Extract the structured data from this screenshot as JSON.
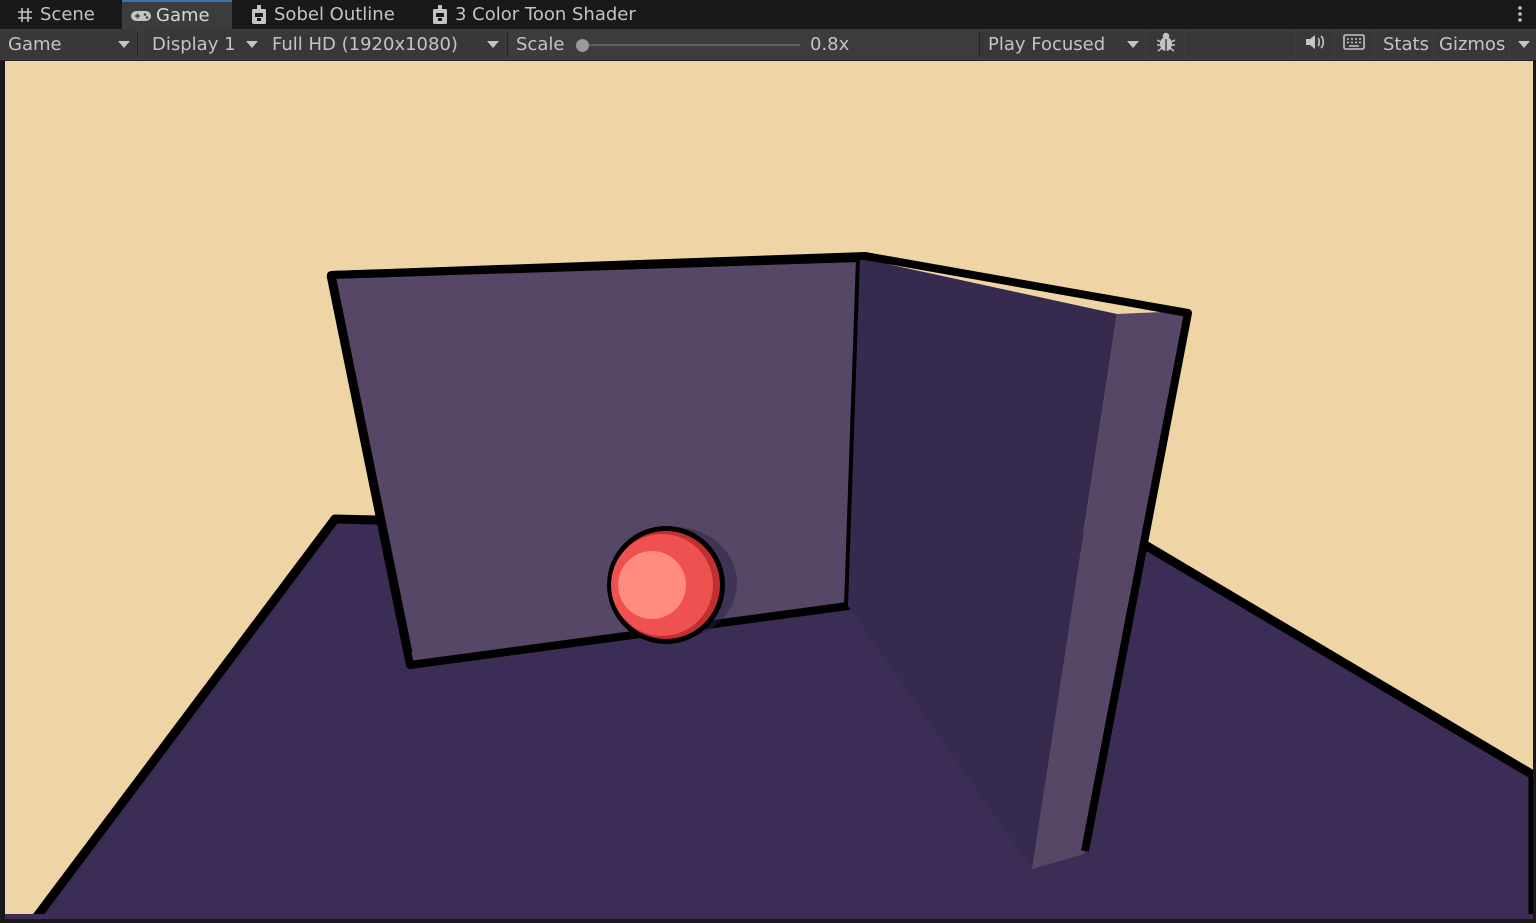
{
  "tabs": [
    {
      "label": "Scene",
      "icon": "grid-icon",
      "active": false
    },
    {
      "label": "Game",
      "icon": "gamepad-icon",
      "active": true
    },
    {
      "label": "Sobel Outline",
      "icon": "shader-graph-icon",
      "active": false
    },
    {
      "label": "3 Color Toon Shader",
      "icon": "shader-graph-icon",
      "active": false
    }
  ],
  "toolbar": {
    "view_mode": "Game",
    "display": "Display 1",
    "resolution": "Full HD (1920x1080)",
    "scale_label": "Scale",
    "scale_value": "0.8x",
    "play_mode": "Play Focused",
    "stats_label": "Stats",
    "gizmos_label": "Gizmos"
  },
  "icons": {
    "bug": "bug-icon",
    "audio": "speaker-icon",
    "keyboard": "keyboard-icon",
    "more": "kebab-menu-icon"
  },
  "colors": {
    "editor_bg": "#191919",
    "toolbar_bg": "#3c3c3c",
    "active_tab_accent": "#3a72b0",
    "sky": "#efd5a5",
    "floor": "#3b2d55",
    "wall_light": "#574767",
    "wall_dark": "#372a4f",
    "outline": "#000000",
    "ball_mid": "#ef5050",
    "ball_highlight": "#ff8c7e",
    "ball_shadow": "#c03030"
  }
}
